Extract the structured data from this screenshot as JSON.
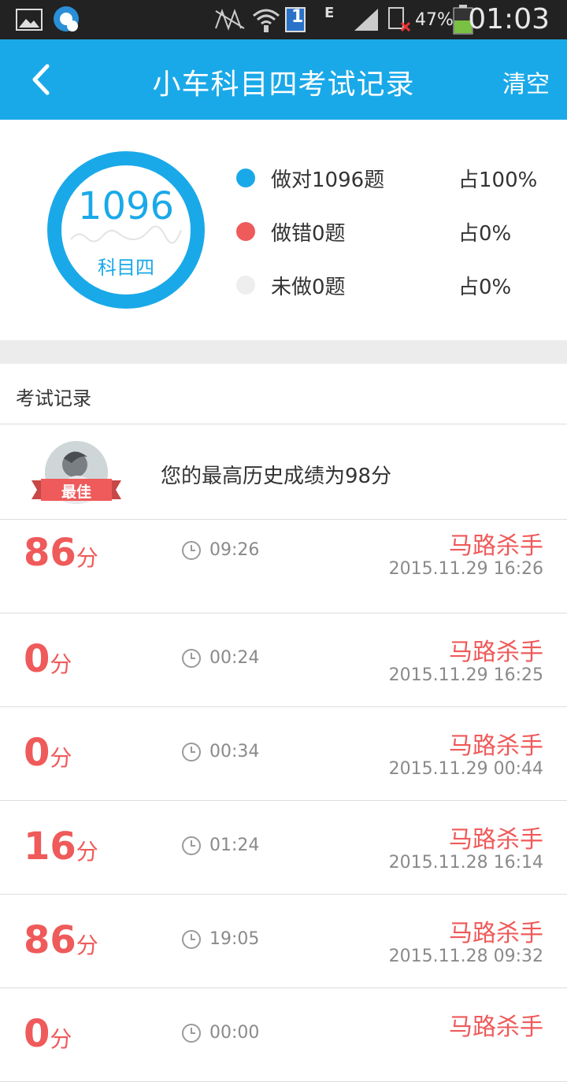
{
  "status_bar": {
    "battery_percent": "47%",
    "time": "01:03",
    "network_type": "E",
    "sim_slot": "1"
  },
  "header": {
    "title": "小车科目四考试记录",
    "clear_label": "清空"
  },
  "summary": {
    "total": "1096",
    "subject": "科目四",
    "legend": [
      {
        "label": "做对1096题",
        "percent": "占100%",
        "color": "#1aa9e8"
      },
      {
        "label": "做错0题",
        "percent": "占0%",
        "color": "#ef5a5a"
      },
      {
        "label": "未做0题",
        "percent": "占0%",
        "color": "#eeeeee"
      }
    ]
  },
  "records_section": {
    "title": "考试记录",
    "best_badge": "最佳",
    "best_text": "您的最高历史成绩为98分"
  },
  "records": [
    {
      "score": "86",
      "unit": "分",
      "duration": "09:26",
      "title": "马路杀手",
      "date": "2015.11.29  16:26"
    },
    {
      "score": "0",
      "unit": "分",
      "duration": "00:24",
      "title": "马路杀手",
      "date": "2015.11.29  16:25"
    },
    {
      "score": "0",
      "unit": "分",
      "duration": "00:34",
      "title": "马路杀手",
      "date": "2015.11.29  00:44"
    },
    {
      "score": "16",
      "unit": "分",
      "duration": "01:24",
      "title": "马路杀手",
      "date": "2015.11.28  16:14"
    },
    {
      "score": "86",
      "unit": "分",
      "duration": "19:05",
      "title": "马路杀手",
      "date": "2015.11.28  09:32"
    },
    {
      "score": "0",
      "unit": "分",
      "duration": "00:00",
      "title": "马路杀手",
      "date": ""
    }
  ],
  "colors": {
    "primary": "#1aa9e8",
    "accent_red": "#ef5a5a",
    "status_bar": "#222222"
  }
}
